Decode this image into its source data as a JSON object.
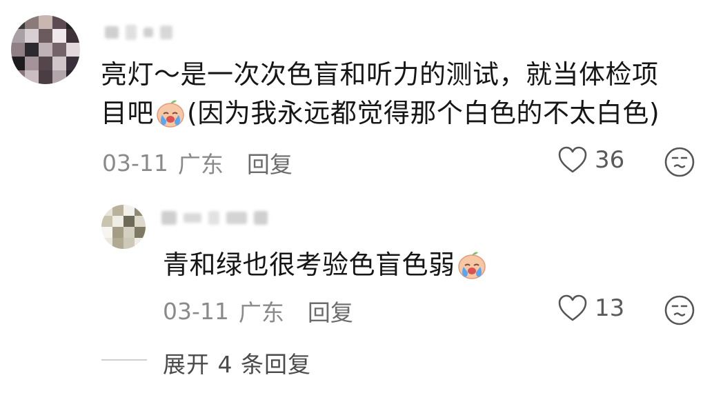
{
  "comment": {
    "text_before_emoji": "亮灯～是一次次色盲和听力的测试，就当体检项目吧",
    "emoji": "crying-face-emoji",
    "text_after_emoji": "(因为我永远都觉得那个白色的不太白色)",
    "date": "03-11",
    "location": "广东",
    "reply_label": "回复",
    "likes": "36"
  },
  "reply": {
    "text": "青和绿也很考验色盲色弱",
    "emoji": "crying-face-emoji",
    "date": "03-11",
    "location": "广东",
    "reply_label": "回复",
    "likes": "13"
  },
  "expand_label": "展开 4 条回复",
  "colors": {
    "text": "#161616",
    "meta": "#8a8a8a",
    "emoji_skin": "#f7c8a6",
    "emoji_tears": "#5aa6f0"
  }
}
